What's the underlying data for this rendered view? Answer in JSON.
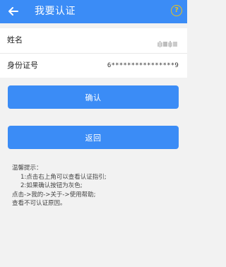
{
  "header": {
    "title": "我要认证",
    "help_glyph": "?",
    "accent_color": "#3b8cf6",
    "help_color": "#e8c21c"
  },
  "form": {
    "name_label": "姓名",
    "id_label": "身份证号",
    "id_value": "6****************9"
  },
  "buttons": {
    "confirm_label": "确认",
    "back_label": "返回"
  },
  "tips": {
    "heading": "温馨提示：",
    "lines": [
      "1:点击右上角可以查看认证指引;",
      "2:如果确认按钮为灰色;",
      "点击->我的->关于->使用帮助;",
      "查看不可认证原因。"
    ]
  }
}
